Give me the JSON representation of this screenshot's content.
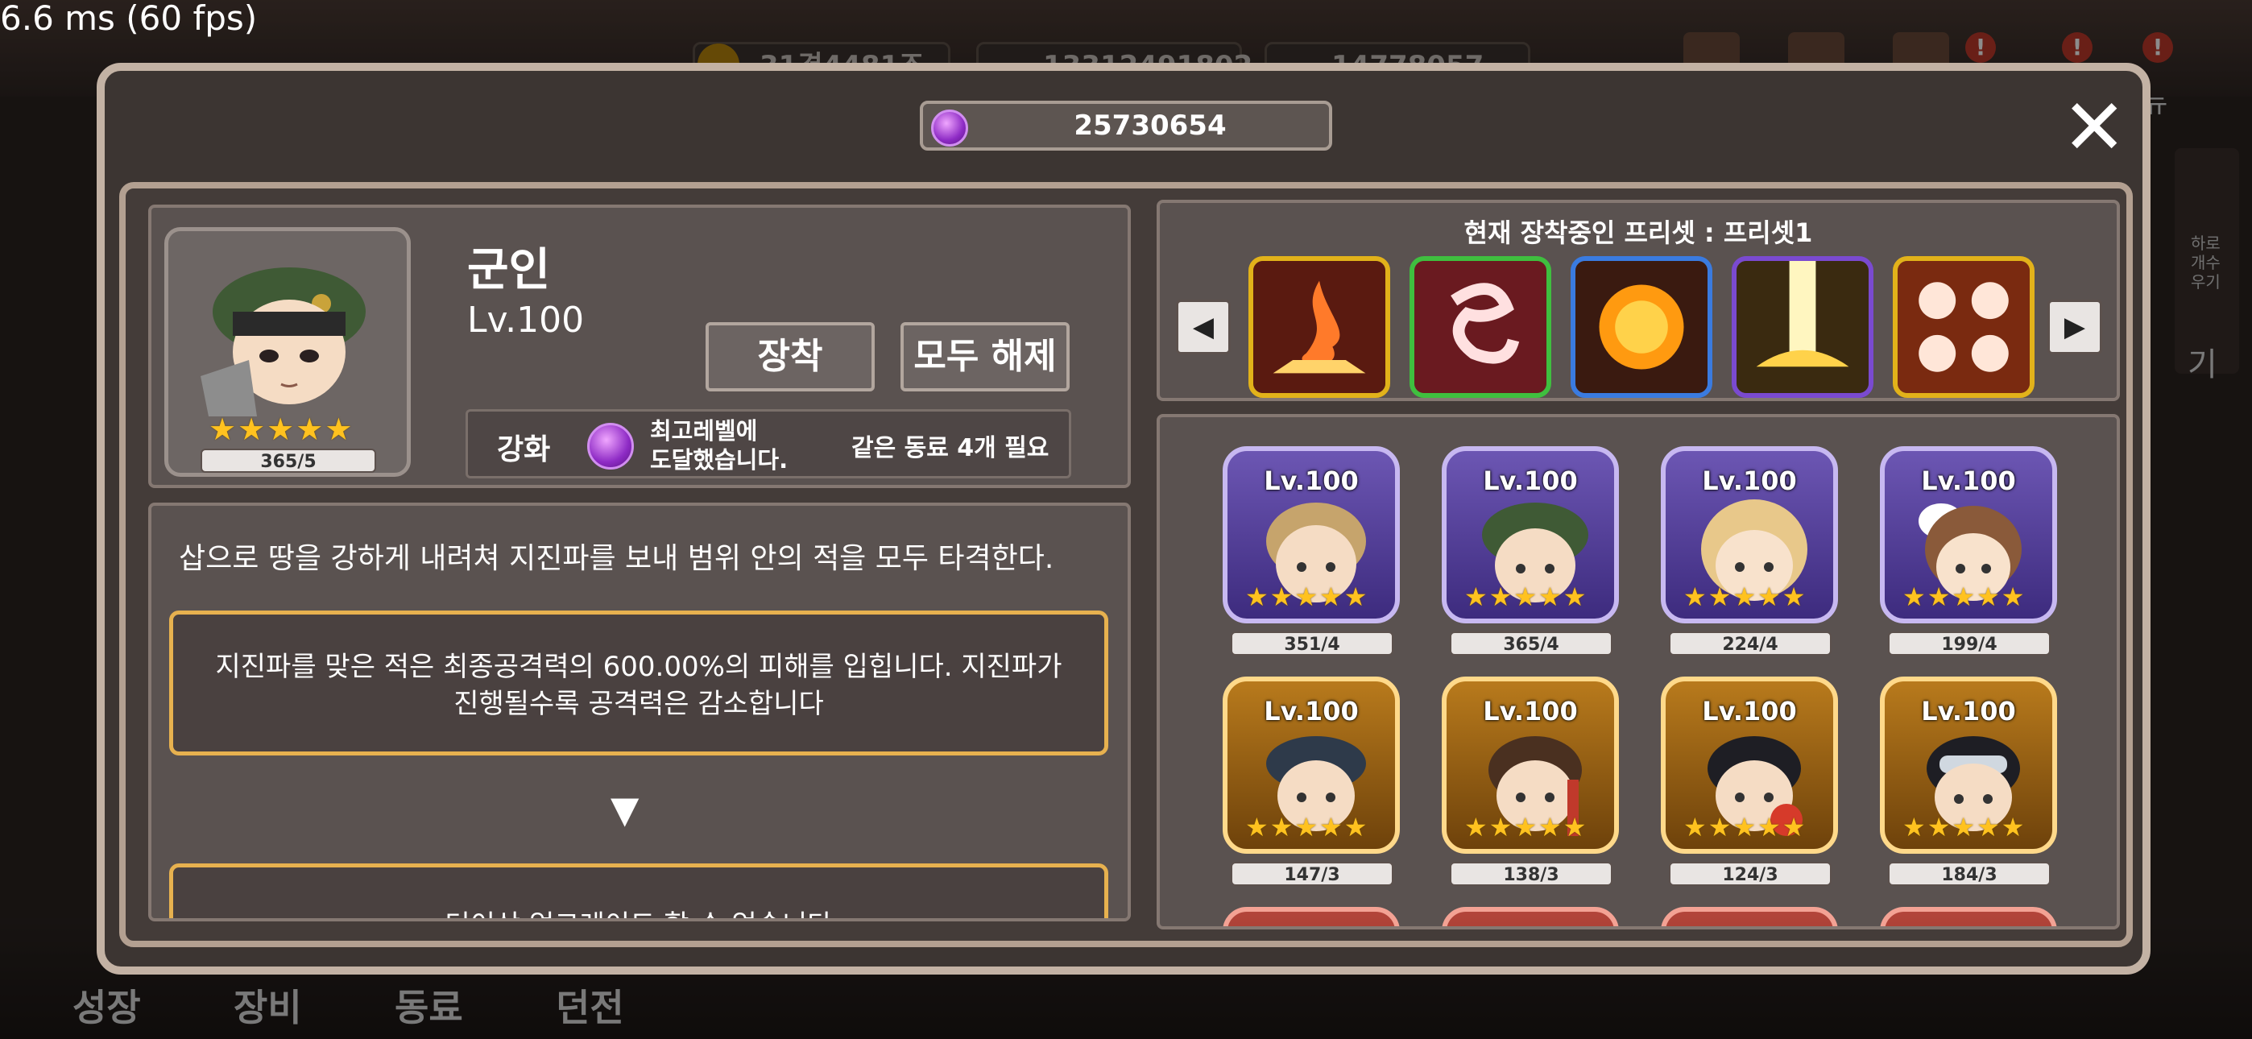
{
  "overlay": {
    "fps_text": "6.6 ms (60 fps)",
    "hud_pills": [
      "31경4481조",
      "13312491802",
      "14778057"
    ],
    "hud_side_label": "뉴",
    "side_texts": [
      "하로",
      "개수",
      "우기",
      "기"
    ],
    "bottom_nav": [
      "성장",
      "장비",
      "동료",
      "던전"
    ]
  },
  "dialog": {
    "currency_value": "25730654",
    "close_label": "✕"
  },
  "character": {
    "name": "군인",
    "level": "Lv.100",
    "count": "365/5",
    "stars": 5,
    "equip_label": "장착",
    "unequip_all_label": "모두 해제",
    "enhance_label": "강화",
    "max_level_msg_line1": "최고레벨에",
    "max_level_msg_line2": "도달했습니다.",
    "need_text": "같은 동료 4개 필요"
  },
  "skill_info": {
    "description": "삽으로 땅을 강하게 내려쳐 지진파를 보내 범위 안의 적을 모두 타격한다.",
    "detail_line1": "지진파를 맞은 적은 최종공격력의 600.00%의 피해를 입힙니다. 지진파가",
    "detail_line2": "진행될수록 공격력은 감소합니다",
    "arrow": "▼",
    "next_text": "더이상 업그레이드 할 수 없습니다"
  },
  "preset": {
    "title": "현재 장착중인 프리셋 : 프리셋1",
    "prev_icon": "left-arrow-icon",
    "next_icon": "right-arrow-icon",
    "skills": [
      {
        "icon": "fire-burst-skill-icon",
        "border": "#e2b21a",
        "bg": "#5a1a10"
      },
      {
        "icon": "vortex-slash-skill-icon",
        "border": "#3fbf3f",
        "bg": "#6a1a20"
      },
      {
        "icon": "sun-explosion-skill-icon",
        "border": "#3a7be0",
        "bg": "#3a1a10"
      },
      {
        "icon": "light-pillar-skill-icon",
        "border": "#7a4ad0",
        "bg": "#3a2a10"
      },
      {
        "icon": "punch-barrage-skill-icon",
        "border": "#e2b21a",
        "bg": "#7a2a10"
      }
    ]
  },
  "companions": [
    {
      "level": "Lv.100",
      "count": "351/4",
      "tier": "purple"
    },
    {
      "level": "Lv.100",
      "count": "365/4",
      "tier": "purple"
    },
    {
      "level": "Lv.100",
      "count": "224/4",
      "tier": "purple"
    },
    {
      "level": "Lv.100",
      "count": "199/4",
      "tier": "purple"
    },
    {
      "level": "Lv.100",
      "count": "147/3",
      "tier": "gold"
    },
    {
      "level": "Lv.100",
      "count": "138/3",
      "tier": "gold"
    },
    {
      "level": "Lv.100",
      "count": "124/3",
      "tier": "gold"
    },
    {
      "level": "Lv.100",
      "count": "184/3",
      "tier": "gold"
    }
  ]
}
